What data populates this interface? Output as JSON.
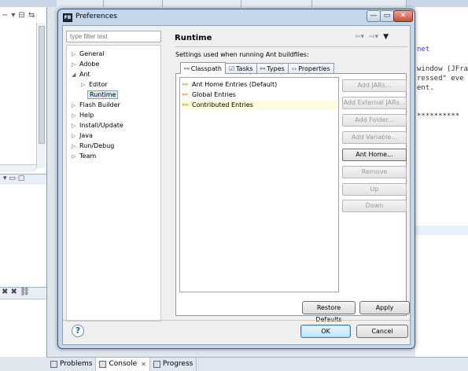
{
  "dialog": {
    "title": "Preferences",
    "app_icon": "FB",
    "window_buttons": {
      "minimize": "—",
      "maximize": "▭",
      "close": "✕"
    }
  },
  "filter": {
    "placeholder": "type filter text"
  },
  "tree": [
    {
      "label": "General",
      "indent": 0,
      "expanded": false
    },
    {
      "label": "Adobe",
      "indent": 0,
      "expanded": false
    },
    {
      "label": "Ant",
      "indent": 0,
      "expanded": true
    },
    {
      "label": "Editor",
      "indent": 1,
      "expanded": false
    },
    {
      "label": "Runtime",
      "indent": 1,
      "selected": true,
      "leaf": true
    },
    {
      "label": "Flash Builder",
      "indent": 0,
      "expanded": false
    },
    {
      "label": "Help",
      "indent": 0,
      "expanded": false
    },
    {
      "label": "Install/Update",
      "indent": 0,
      "expanded": false
    },
    {
      "label": "Java",
      "indent": 0,
      "expanded": false
    },
    {
      "label": "Run/Debug",
      "indent": 0,
      "expanded": false
    },
    {
      "label": "Team",
      "indent": 0,
      "expanded": false
    }
  ],
  "page": {
    "title": "Runtime",
    "description": "Settings used when running Ant buildfiles:",
    "nav_icons": [
      "back-arrow-icon",
      "forward-arrow-icon",
      "menu-dropdown-icon"
    ]
  },
  "tabs": [
    {
      "label": "Classpath",
      "icon": "classpath-icon",
      "active": true
    },
    {
      "label": "Tasks",
      "icon": "tasks-icon",
      "active": false
    },
    {
      "label": "Types",
      "icon": "types-icon",
      "active": false
    },
    {
      "label": "Properties",
      "icon": "properties-icon",
      "active": false
    }
  ],
  "entries": [
    {
      "label": "Ant Home Entries (Default)"
    },
    {
      "label": "Global Entries"
    },
    {
      "label": "Contributed Entries",
      "highlighted": true
    }
  ],
  "side_buttons": [
    {
      "label": "Add JARs...",
      "enabled": false
    },
    {
      "label": "Add External JARs...",
      "enabled": false
    },
    {
      "label": "Add Folder...",
      "enabled": false
    },
    {
      "label": "Add Variable...",
      "enabled": false
    },
    {
      "label": "Ant Home...",
      "enabled": true
    },
    {
      "label": "Remove",
      "enabled": false
    },
    {
      "label": "Up",
      "enabled": false
    },
    {
      "label": "Down",
      "enabled": false
    }
  ],
  "buttons": {
    "restore_defaults": "Restore Defaults",
    "apply": "Apply",
    "ok": "OK",
    "cancel": "Cancel",
    "help": "?"
  },
  "background": {
    "code_lines": [
      "net",
      "window (JFra",
      "ressed\" eve",
      "ent.",
      "**********"
    ],
    "bottom_tabs": [
      {
        "label": "Problems",
        "active": false
      },
      {
        "label": "Console",
        "active": true,
        "closable": true
      },
      {
        "label": "Progress",
        "active": false
      }
    ]
  }
}
